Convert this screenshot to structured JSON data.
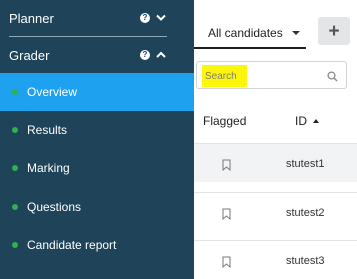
{
  "sidebar": {
    "sections": {
      "planner": {
        "label": "Planner"
      },
      "grader": {
        "label": "Grader"
      }
    },
    "items": [
      {
        "label": "Overview",
        "active": true
      },
      {
        "label": "Results",
        "active": false
      },
      {
        "label": "Marking",
        "active": false
      },
      {
        "label": "Questions",
        "active": false
      },
      {
        "label": "Candidate report",
        "active": false
      }
    ]
  },
  "main": {
    "filter": {
      "selected": "All candidates"
    },
    "add_button": {
      "label": "+"
    },
    "search": {
      "placeholder": "Search",
      "value": ""
    },
    "columns": {
      "flagged": "Flagged",
      "id": "ID"
    },
    "rows": [
      {
        "id": "stutest1"
      },
      {
        "id": "stutest2"
      },
      {
        "id": "stutest3"
      }
    ]
  },
  "colors": {
    "sidebar_bg": "#1f4359",
    "active_item": "#1ea2f0",
    "status_dot": "#2fb14e",
    "search_highlight": "#fcf70a"
  }
}
